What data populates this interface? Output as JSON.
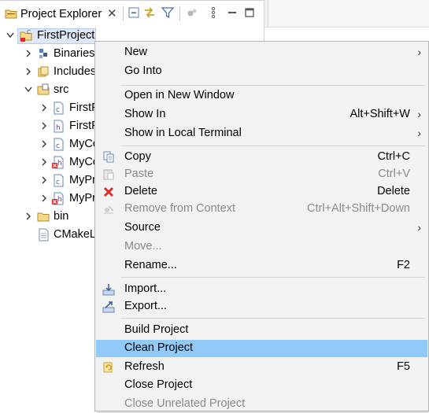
{
  "view": {
    "tab_title": "Project Explorer",
    "close_glyph": "✕"
  },
  "toolbar": {
    "buttons": [
      "collapse-all-icon",
      "link-with-editor-icon",
      "filter-icon",
      "focus-on-active-task-icon",
      "view-menu-icon",
      "minimize-icon",
      "maximize-icon"
    ]
  },
  "tree": {
    "project": "FirstProject",
    "items": [
      {
        "label": "Binaries",
        "icon": "binaries-icon"
      },
      {
        "label": "Includes",
        "icon": "includes-icon"
      },
      {
        "label": "src",
        "icon": "source-folder-icon"
      },
      {
        "label": "FirstP",
        "icon": "c-source-file-icon"
      },
      {
        "label": "FirstP",
        "icon": "header-file-icon"
      },
      {
        "label": "MyCo",
        "icon": "c-source-file-icon"
      },
      {
        "label": "MyCo",
        "icon": "header-file-error-icon"
      },
      {
        "label": "MyPr",
        "icon": "c-source-file-icon"
      },
      {
        "label": "MyPr",
        "icon": "header-file-error-icon"
      },
      {
        "label": "bin",
        "icon": "folder-icon"
      },
      {
        "label": "CMakeL",
        "icon": "text-file-icon"
      }
    ]
  },
  "menu": {
    "items": [
      {
        "label": "New",
        "submenu": true
      },
      {
        "label": "Go Into"
      },
      {
        "label": "Open in New Window"
      },
      {
        "label": "Show In",
        "accel": "Alt+Shift+W",
        "submenu": true
      },
      {
        "label": "Show in Local Terminal",
        "submenu": true
      },
      {
        "label": "Copy",
        "accel": "Ctrl+C",
        "icon": "copy-icon"
      },
      {
        "label": "Paste",
        "accel": "Ctrl+V",
        "icon": "paste-icon",
        "disabled": true
      },
      {
        "label": "Delete",
        "accel": "Delete",
        "icon": "delete-icon"
      },
      {
        "label": "Remove from Context",
        "accel": "Ctrl+Alt+Shift+Down",
        "icon": "remove-context-icon",
        "disabled": true
      },
      {
        "label": "Source",
        "submenu": true
      },
      {
        "label": "Move...",
        "disabled": true
      },
      {
        "label": "Rename...",
        "accel": "F2"
      },
      {
        "label": "Import...",
        "icon": "import-icon"
      },
      {
        "label": "Export...",
        "icon": "export-icon"
      },
      {
        "label": "Build Project"
      },
      {
        "label": "Clean Project",
        "highlighted": true
      },
      {
        "label": "Refresh",
        "accel": "F5",
        "icon": "refresh-icon"
      },
      {
        "label": "Close Project"
      },
      {
        "label": "Close Unrelated Project",
        "disabled": true
      }
    ],
    "submenu_glyph": "›"
  },
  "colors": {
    "highlight": "#91c9f7",
    "selection": "#dde7f5",
    "disabled_text": "#8a8a8a",
    "delete_red": "#d9302c"
  }
}
